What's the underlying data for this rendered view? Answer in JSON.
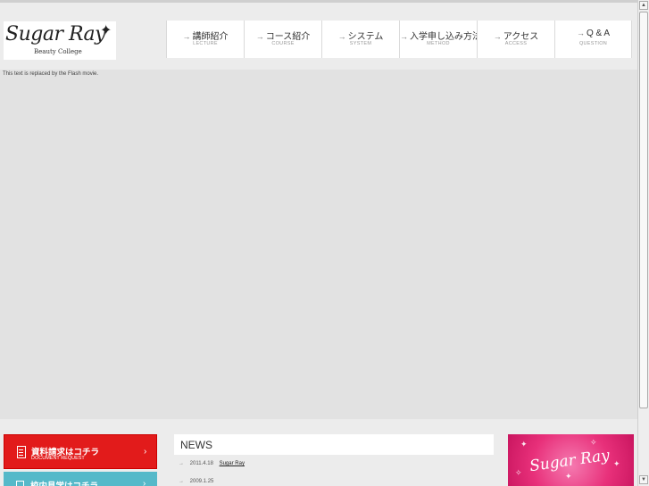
{
  "logo": {
    "script": "Sugar Ray",
    "star": "✦",
    "subtitle": "Beauty College"
  },
  "nav": {
    "arrow": "→",
    "items": [
      {
        "label": "講師紹介",
        "sub": "LECTURE"
      },
      {
        "label": "コース紹介",
        "sub": "COURSE"
      },
      {
        "label": "システム",
        "sub": "SYSTEM"
      },
      {
        "label": "入学申し込み方法",
        "sub": "METHOD"
      },
      {
        "label": "アクセス",
        "sub": "ACCESS"
      },
      {
        "label": "Q & A",
        "sub": "QUESTION"
      }
    ]
  },
  "flash": {
    "placeholder": "This text is replaced by the Flash movie."
  },
  "buttons": {
    "document": {
      "label": "資料請求はコチラ",
      "sub": "DOCUMENT REQUEST",
      "chevron": "›"
    },
    "visit": {
      "label": "校内見学はコチラ",
      "chevron": "›"
    }
  },
  "news": {
    "title": "NEWS",
    "arrow": "→",
    "items": [
      {
        "date": "2011.4.18",
        "link": "Sugar Ray"
      },
      {
        "date": "2009.1.25",
        "link": ""
      }
    ]
  },
  "banner": {
    "text": "Sugar Ray"
  },
  "scrollbar": {
    "up": "▲",
    "down": "▼"
  }
}
